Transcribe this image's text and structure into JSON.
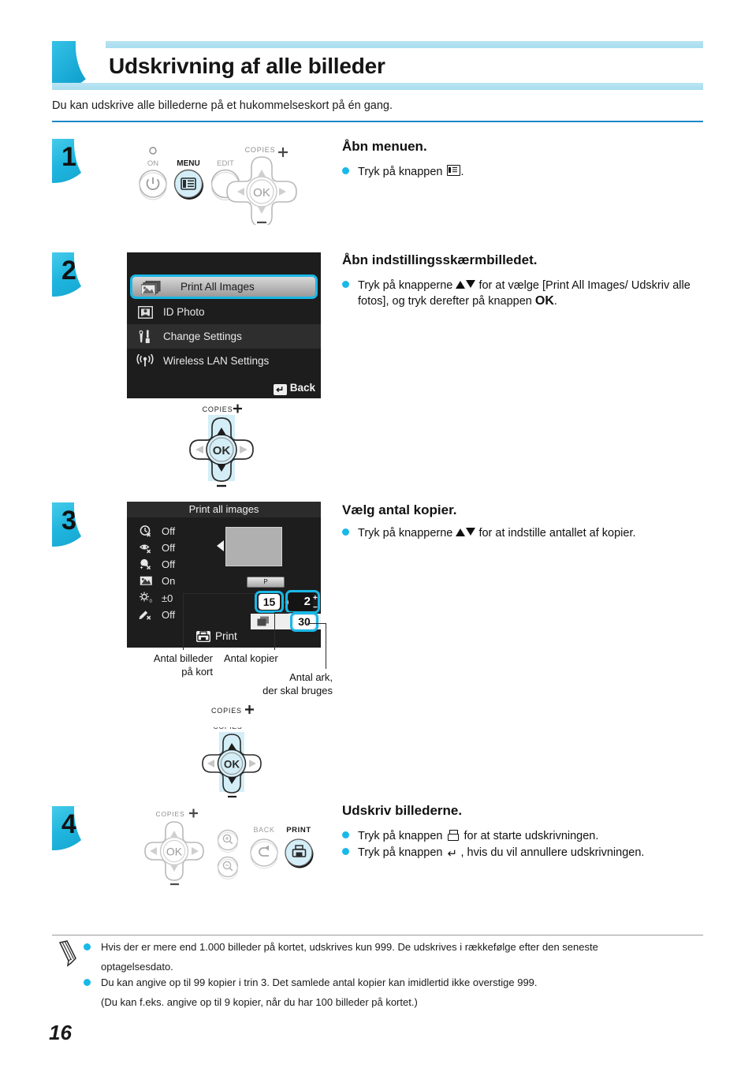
{
  "page": {
    "title": "Udskrivning af alle billeder",
    "intro": "Du kan udskrive alle billederne på et hukommelseskort på én gang.",
    "number": "16",
    "accent": "#18b9e8",
    "rule_color": "#1b87c6"
  },
  "steps": [
    {
      "num": "1",
      "title": "Åbn menuen.",
      "bullets": [
        "Tryk på knappen ."
      ]
    },
    {
      "num": "2",
      "title": "Åbn indstillingsskærmbilledet.",
      "bullets": [
        "Tryk på knapperne  for at vælge [Print All Images/ Udskriv alle fotos], og tryk derefter på knappen OK."
      ]
    },
    {
      "num": "3",
      "title": "Vælg antal kopier.",
      "bullets": [
        "Tryk på knapperne  for at indstille antallet af kopier."
      ]
    },
    {
      "num": "4",
      "title": "Udskriv billederne.",
      "bullets": [
        "Tryk på knappen  for at starte udskrivningen.",
        "Tryk på knappen , hvis du vil annullere udskrivningen."
      ]
    }
  ],
  "step1_text": {
    "pre": "Tryk på knappen",
    "post": "."
  },
  "step2_text": {
    "pre": "Tryk på knapperne",
    "mid": "for at vælge [Print All Images/",
    "line2_a": "Udskriv alle fotos], og tryk derefter på knappen",
    "ok": "OK",
    "line2_b": "."
  },
  "step3_text": {
    "pre": "Tryk på knapperne",
    "post": "for at indstille antallet af kopier."
  },
  "step4_text": {
    "b1_pre": "Tryk på knappen",
    "b1_post": "for at starte udskrivningen.",
    "b2_pre": "Tryk på knappen",
    "b2_post": ", hvis du vil annullere udskrivningen."
  },
  "menu_screen": {
    "items": [
      {
        "label": "Print All Images",
        "icon": "images-stack-icon",
        "selected": true
      },
      {
        "label": "ID Photo",
        "icon": "id-photo-icon",
        "selected": false
      },
      {
        "label": "Change Settings",
        "icon": "wrench-icon",
        "selected": false
      },
      {
        "label": "Wireless LAN Settings",
        "icon": "wifi-icon",
        "selected": false
      }
    ],
    "back_label": "Back",
    "back_icon": "return-arrow-icon"
  },
  "print_screen": {
    "title": "Print all images",
    "options": [
      {
        "icon": "date-off-icon",
        "value": "Off"
      },
      {
        "icon": "redeye-off-icon",
        "value": "Off"
      },
      {
        "icon": "skin-smooth-off-icon",
        "value": "Off"
      },
      {
        "icon": "image-optimize-icon",
        "value": "On"
      },
      {
        "icon": "brightness-icon",
        "value": "±0"
      },
      {
        "icon": "effect-off-icon",
        "value": "Off"
      }
    ],
    "page_chip": "P",
    "images_on_card": "15",
    "copies": "2",
    "sheets_needed": "30",
    "plus_sign": "+",
    "minus_sign": "−",
    "print_label": "Print",
    "print_icon": "printer-icon"
  },
  "callouts": {
    "images_on_card": "Antal billeder\npå kort",
    "images_on_card_l1": "Antal billeder",
    "images_on_card_l2": "på kort",
    "copies": "Antal kopier",
    "sheets_l1": "Antal ark,",
    "sheets_l2": "der skal bruges"
  },
  "panel1": {
    "led_label": "ON",
    "menu_label": "MENU",
    "edit_label": "EDIT",
    "copies_label": "COPIES",
    "ok_label": "OK",
    "power_icon": "power-icon",
    "menu_icon": "menu-icon"
  },
  "panel2": {
    "copies_label": "COPIES",
    "ok_label": "OK"
  },
  "panel3": {
    "copies_label": "COPIES",
    "ok_label": "OK"
  },
  "panel4": {
    "copies_label": "COPIES",
    "ok_label": "OK",
    "back_label": "BACK",
    "print_label": "PRINT",
    "zoom_in_icon": "zoom-in-icon",
    "zoom_out_icon": "zoom-out-icon",
    "back_icon": "return-arrow-icon",
    "print_icon": "printer-icon"
  },
  "notes": {
    "icon": "pencil-note-icon",
    "items": [
      {
        "l1": "Hvis der er mere end 1.000 billeder på kortet, udskrives kun 999. De udskrives i rækkefølge efter den seneste",
        "l2": "optagelsesdato."
      },
      {
        "l1": "Du kan angive op til 99 kopier i trin 3. Det samlede antal kopier kan imidlertid ikke overstige 999.",
        "l2": "(Du kan f.eks. angive op til 9 kopier, når du har 100 billeder på kortet.)"
      }
    ]
  }
}
